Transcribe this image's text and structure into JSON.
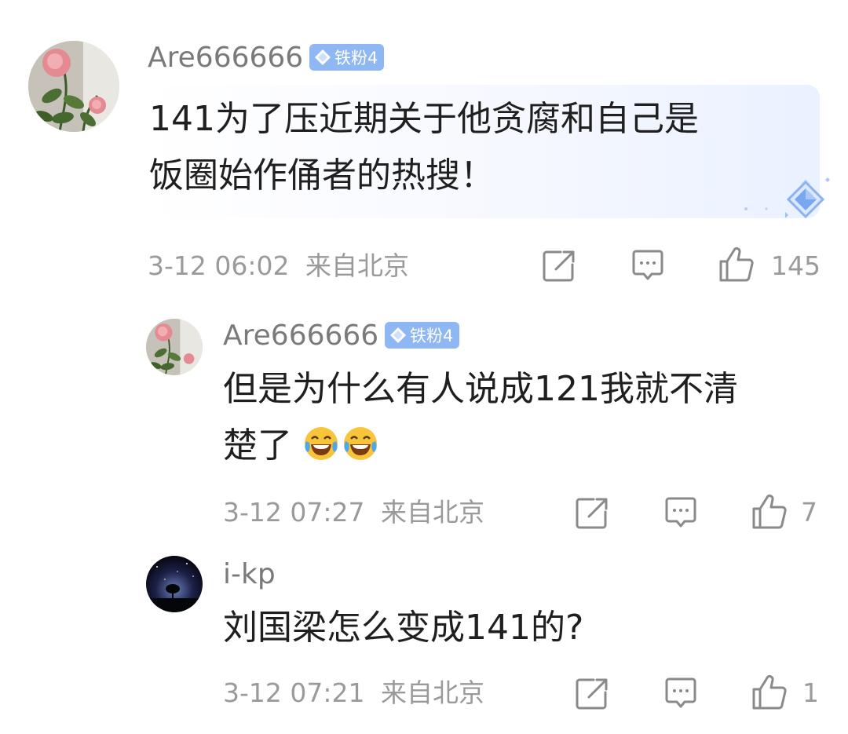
{
  "comments": [
    {
      "username": "Are666666",
      "badge": "铁粉4",
      "text_lines": [
        "141为了压近期关于他贪腐和自己是",
        "饭圈始作俑者的热搜！"
      ],
      "time": "3-12 06:02",
      "location": "来自北京",
      "likes": "145"
    },
    {
      "username": "Are666666",
      "badge": "铁粉4",
      "text_lines": [
        "但是为什么有人说成121我就不清",
        "楚了"
      ],
      "emojis": [
        "laugh-cry-emoji",
        "laugh-cry-emoji"
      ],
      "time": "3-12 07:27",
      "location": "来自北京",
      "likes": "7"
    },
    {
      "username": "i-kp",
      "text_lines": [
        "刘国梁怎么变成141的?"
      ],
      "time": "3-12 07:21",
      "location": "来自北京",
      "likes": "1"
    }
  ],
  "icons": [
    "forward-icon",
    "comment-icon",
    "like-icon",
    "diamond-badge-icon",
    "flower-avatar",
    "night-tree-avatar"
  ],
  "colors": {
    "badge": "#8fb7f4",
    "username": "#7a7a7a",
    "meta": "#9a9a9a",
    "text": "#1f1f1f"
  }
}
